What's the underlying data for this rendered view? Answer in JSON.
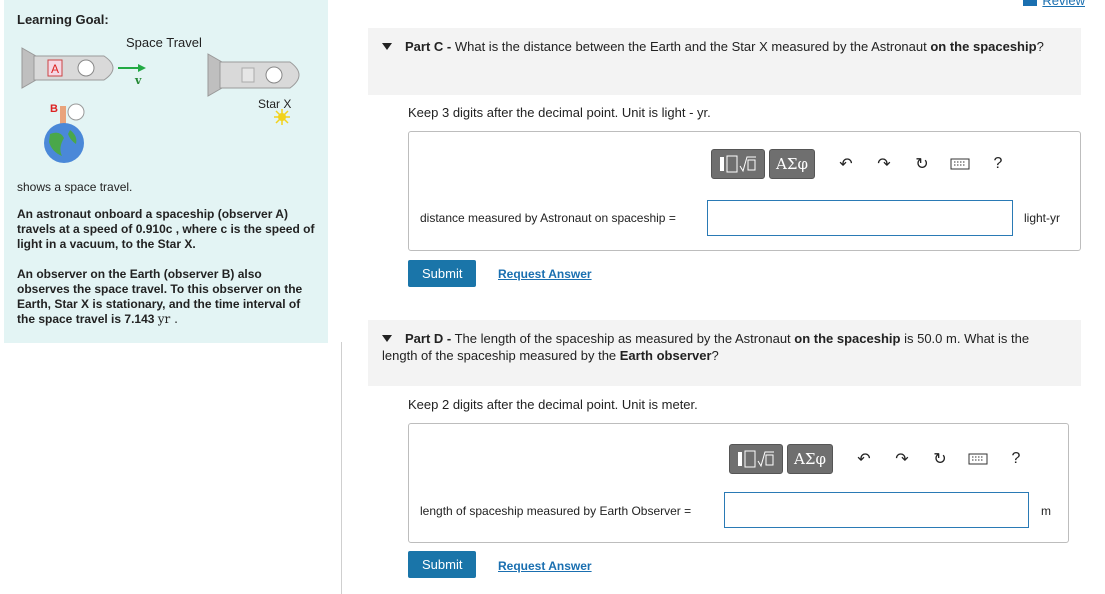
{
  "left": {
    "title": "Learning Goal:",
    "figure": {
      "title": "Space Travel",
      "label_a": "A",
      "label_b": "B",
      "star_label": "Star X",
      "velocity_label": "v"
    },
    "caption": "shows a space travel.",
    "para1": "An astronaut onboard a spaceship (observer A) travels at a speed of 0.910c , where c is the speed of light in a vacuum, to the Star X.",
    "para2_text": "An observer on the Earth (observer B) also observes the space travel. To this observer on the Earth, Star X is stationary, and the time interval of the space travel is 7.143",
    "para2_unit": "yr ."
  },
  "header": {
    "review_label": "Review"
  },
  "partC": {
    "label": "Part C -",
    "q_text": " What is the distance between the Earth and the Star X measured by the Astronaut ",
    "q_bold": "on the spaceship",
    "q_end": "?",
    "instruction": "Keep 3 digits after the decimal point. Unit is light - yr.",
    "answer_label": "distance measured by Astronaut on spaceship =",
    "answer_value": "",
    "unit": "light-yr",
    "submit_label": "Submit",
    "request_label": "Request Answer"
  },
  "partD": {
    "label": "Part D -",
    "q_text1": " The length of the spaceship as measured by the Astronaut ",
    "q_bold1": "on the spaceship",
    "q_text2": " is 50.0 m. What is the length of the spaceship measured by the ",
    "q_bold2": "Earth observer",
    "q_end": "?",
    "instruction": "Keep 2 digits after the decimal point. Unit is meter.",
    "answer_label": "length of spaceship measured by Earth Observer =",
    "answer_value": "",
    "unit": "m",
    "submit_label": "Submit",
    "request_label": "Request Answer"
  },
  "toolbar": {
    "templates_icon": "templates-icon",
    "greek_label": "ΑΣφ",
    "undo_icon": "undo-icon",
    "redo_icon": "redo-icon",
    "reset_icon": "reset-icon",
    "keyboard_icon": "keyboard-icon",
    "help_label": "?"
  }
}
